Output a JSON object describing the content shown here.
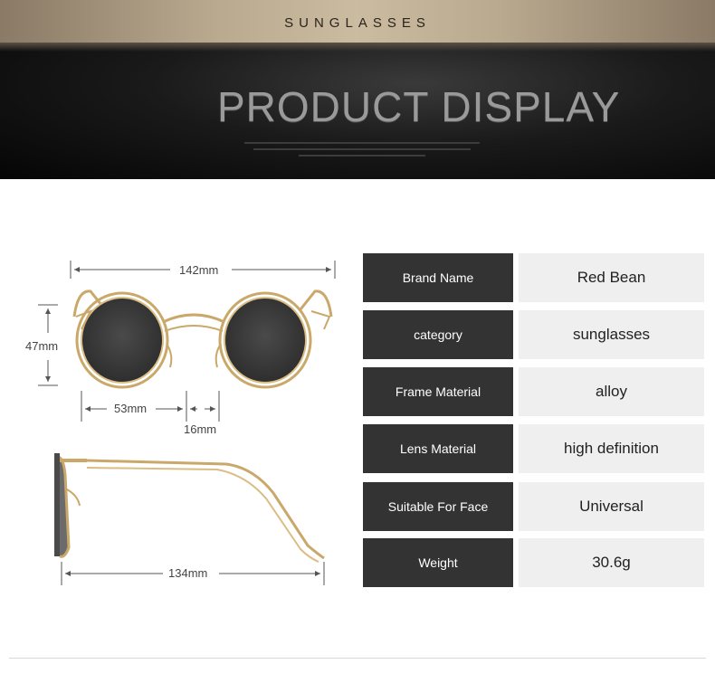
{
  "banner": {
    "subtitle": "SUNGLASSES",
    "title": "PRODUCT DISPLAY"
  },
  "dimensions": {
    "total_width": "142mm",
    "lens_height": "47mm",
    "lens_width": "53mm",
    "bridge": "16mm",
    "temple_length": "134mm"
  },
  "specs": [
    {
      "label": "Brand Name",
      "value": "Red Bean"
    },
    {
      "label": "category",
      "value": "sunglasses"
    },
    {
      "label": "Frame Material",
      "value": "alloy"
    },
    {
      "label": "Lens Material",
      "value": "high definition"
    },
    {
      "label": "Suitable For Face",
      "value": "Universal"
    },
    {
      "label": "Weight",
      "value": "30.6g"
    }
  ],
  "colors": {
    "label_bg": "#333333",
    "value_bg": "#efefef",
    "frame_gold": "#c9a86a",
    "lens_gray": "#3e3e3e"
  }
}
